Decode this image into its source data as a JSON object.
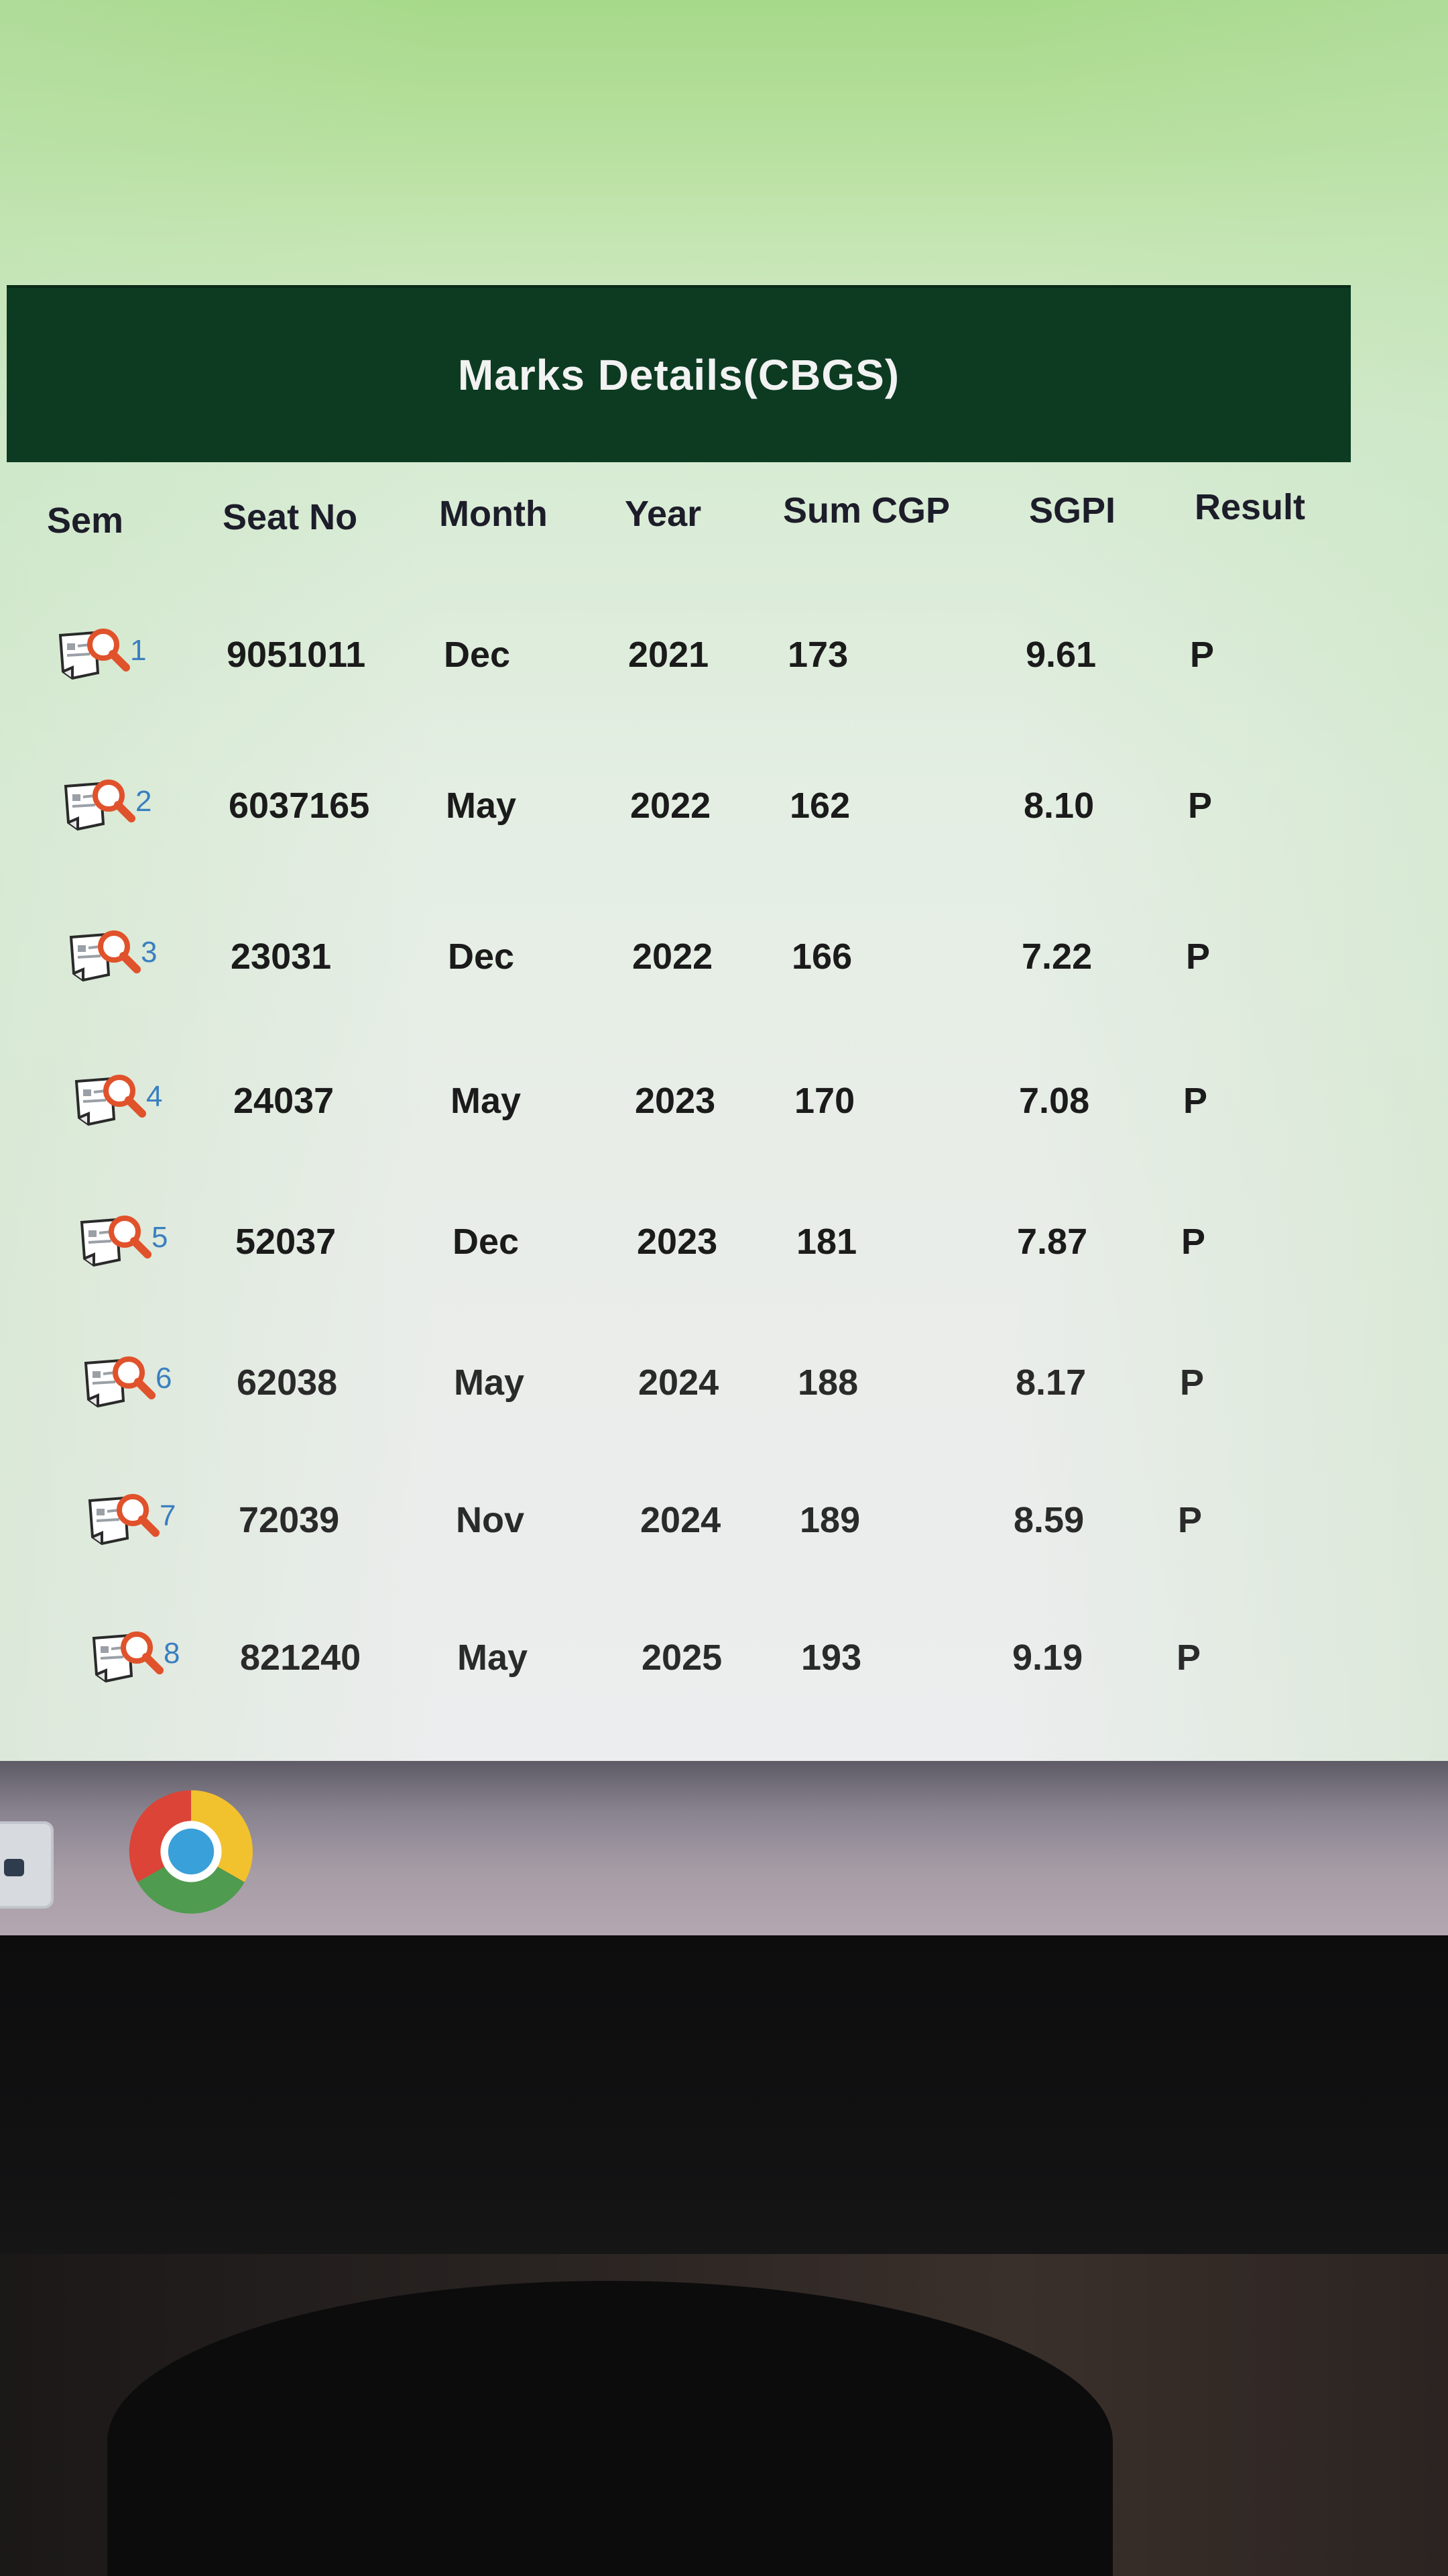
{
  "panel": {
    "title": "Marks Details(CBGS)"
  },
  "table": {
    "headers": {
      "sem": "Sem",
      "seat_no": "Seat No",
      "month": "Month",
      "year": "Year",
      "sum_cgp": "Sum CGP",
      "sgpi": "SGPI",
      "result": "Result"
    },
    "rows": [
      {
        "sem": "1",
        "seat_no": "9051011",
        "month": "Dec",
        "year": "2021",
        "sum_cgp": "173",
        "sgpi": "9.61",
        "result": "P"
      },
      {
        "sem": "2",
        "seat_no": "6037165",
        "month": "May",
        "year": "2022",
        "sum_cgp": "162",
        "sgpi": "8.10",
        "result": "P"
      },
      {
        "sem": "3",
        "seat_no": "23031",
        "month": "Dec",
        "year": "2022",
        "sum_cgp": "166",
        "sgpi": "7.22",
        "result": "P"
      },
      {
        "sem": "4",
        "seat_no": "24037",
        "month": "May",
        "year": "2023",
        "sum_cgp": "170",
        "sgpi": "7.08",
        "result": "P"
      },
      {
        "sem": "5",
        "seat_no": "52037",
        "month": "Dec",
        "year": "2023",
        "sum_cgp": "181",
        "sgpi": "7.87",
        "result": "P"
      },
      {
        "sem": "6",
        "seat_no": "62038",
        "month": "May",
        "year": "2024",
        "sum_cgp": "188",
        "sgpi": "8.17",
        "result": "P"
      },
      {
        "sem": "7",
        "seat_no": "72039",
        "month": "Nov",
        "year": "2024",
        "sum_cgp": "189",
        "sgpi": "8.59",
        "result": "P"
      },
      {
        "sem": "8",
        "seat_no": "821240",
        "month": "May",
        "year": "2025",
        "sum_cgp": "193",
        "sgpi": "9.19",
        "result": "P"
      }
    ]
  },
  "icons": {
    "row_icon": "document-search-icon",
    "taskbar_app": "chrome-icon",
    "taskbar_left": "app-tile-icon"
  },
  "colors": {
    "header_bg": "#0c3b22",
    "sem_number": "#3a7fc0",
    "magnifier": "#e0522b"
  }
}
